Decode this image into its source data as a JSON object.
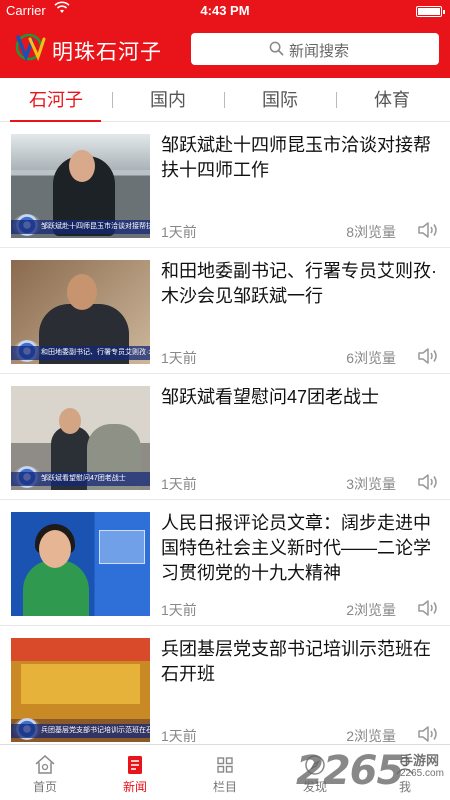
{
  "status_bar": {
    "carrier": "Carrier",
    "time": "4:43 PM"
  },
  "header": {
    "brand": "明珠石河子",
    "search_placeholder": "新闻搜索",
    "accent_color": "#e8141a"
  },
  "tabs": [
    {
      "label": "石河子",
      "active": true
    },
    {
      "label": "国内",
      "active": false
    },
    {
      "label": "国际",
      "active": false
    },
    {
      "label": "体育",
      "active": false
    }
  ],
  "news": [
    {
      "title": "邹跃斌赴十四师昆玉市洽谈对接帮扶十四师工作",
      "time": "1天前",
      "views": "8浏览量",
      "thumb_caption": "邹跃斌赴十四师昆玉市洽谈对接帮扶十四师工作"
    },
    {
      "title": "和田地委副书记、行署专员艾则孜·木沙会见邹跃斌一行",
      "time": "1天前",
      "views": "6浏览量",
      "thumb_caption": "和田地委副书记、行署专员艾则孜·木沙会见邹跃斌一行"
    },
    {
      "title": "邹跃斌看望慰问47团老战士",
      "time": "1天前",
      "views": "3浏览量",
      "thumb_caption": "邹跃斌看望慰问47团老战士"
    },
    {
      "title": "人民日报评论员文章：阔步走进中国特色社会主义新时代——二论学习贯彻党的十九大精神",
      "time": "1天前",
      "views": "2浏览量",
      "thumb_caption": ""
    },
    {
      "title": "兵团基层党支部书记培训示范班在石开班",
      "time": "1天前",
      "views": "2浏览量",
      "thumb_caption": "兵团基层党支部书记培训示范班在石开班"
    }
  ],
  "bottom_nav": [
    {
      "label": "首页",
      "icon": "home-icon",
      "active": false
    },
    {
      "label": "新闻",
      "icon": "news-icon",
      "active": true
    },
    {
      "label": "栏目",
      "icon": "grid-icon",
      "active": false
    },
    {
      "label": "发现",
      "icon": "compass-icon",
      "active": false
    },
    {
      "label": "我",
      "icon": "user-icon",
      "active": false
    }
  ],
  "watermark": {
    "number": "2265",
    "site": "手游网",
    "url": "2265.com"
  }
}
